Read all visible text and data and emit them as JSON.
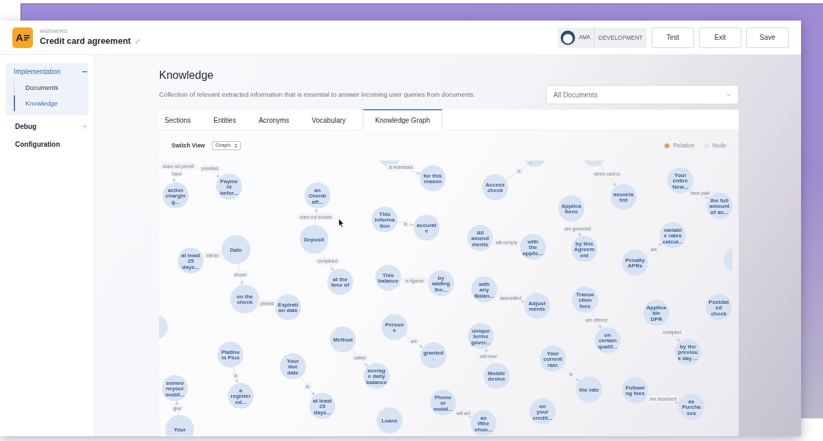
{
  "header": {
    "logo_letter": "A",
    "product": "ANSWERS",
    "title": "Credit card agreement",
    "assistant": "AVA",
    "environment": "DEVELOPMENT",
    "buttons": [
      "Test",
      "Exit",
      "Save"
    ]
  },
  "sidebar": [
    {
      "label": "Implementation",
      "kind": "group",
      "expanded": true,
      "children": [
        {
          "label": "Documents",
          "selected": false
        },
        {
          "label": "Knowledge",
          "selected": true
        }
      ]
    },
    {
      "label": "Debug",
      "kind": "group",
      "expanded": false
    },
    {
      "label": "Configuration",
      "kind": "link"
    }
  ],
  "page": {
    "title": "Knowledge",
    "description": "Collection of relevant extracted information that is essential to answer incoming user queries from documents.",
    "filter": "All Documents"
  },
  "tabs": [
    {
      "label": "Sections",
      "selected": false
    },
    {
      "label": "Entities",
      "selected": false
    },
    {
      "label": "Acronyms",
      "selected": false
    },
    {
      "label": "Vocabulary",
      "selected": false
    },
    {
      "label": "Knowledge Graph",
      "selected": true
    }
  ],
  "graph": {
    "switch_label": "Switch View",
    "view": "Graph",
    "legend": [
      {
        "label": "Relation",
        "color": "#e0a050"
      },
      {
        "label": "Node",
        "color": "#dde3ee"
      }
    ],
    "nodes": [
      {
        "lines": [
          "active",
          "chargin",
          "g..."
        ]
      },
      {
        "lines": [
          "Payme",
          "nt",
          "befor..."
        ]
      },
      {
        "lines": [
          "an",
          "Overdr",
          "aft..."
        ]
      },
      {
        "lines": [
          "for this",
          "reason"
        ]
      },
      {
        "lines": [
          "Access",
          "check"
        ]
      },
      {
        "lines": [
          "Applica",
          "tions"
        ]
      },
      {
        "lines": [
          "associa",
          "ted"
        ]
      },
      {
        "lines": [
          "Your",
          "entire",
          "New..."
        ]
      },
      {
        "lines": [
          "the full",
          "amount",
          "of an..."
        ]
      },
      {
        "lines": [
          "at least",
          "25",
          "days..."
        ]
      },
      {
        "lines": [
          "Date"
        ]
      },
      {
        "lines": [
          "Deposit"
        ]
      },
      {
        "lines": [
          "This",
          "informa",
          "tion"
        ]
      },
      {
        "lines": [
          "accurat",
          "e"
        ]
      },
      {
        "lines": [
          "All",
          "amend",
          "ments"
        ]
      },
      {
        "lines": [
          "with",
          "the",
          "applic..."
        ]
      },
      {
        "lines": [
          "by this",
          "Agreem",
          "ent"
        ]
      },
      {
        "lines": [
          "Penalty",
          "APRs"
        ]
      },
      {
        "lines": [
          "variabl",
          "e rates",
          "calcul..."
        ]
      },
      {
        "lines": [
          "on the",
          "check"
        ]
      },
      {
        "lines": [
          "Expirati",
          "on date"
        ]
      },
      {
        "lines": [
          "at the",
          "time of"
        ]
      },
      {
        "lines": [
          "This",
          "balance"
        ]
      },
      {
        "lines": [
          "by",
          "adding",
          "the..."
        ]
      },
      {
        "lines": [
          "with",
          "any",
          "Balan..."
        ]
      },
      {
        "lines": [
          "Adjust",
          "ments"
        ]
      },
      {
        "lines": [
          "Transa",
          "ction",
          "fees"
        ]
      },
      {
        "lines": [
          "Applica",
          "ble",
          "DPR"
        ]
      },
      {
        "lines": [
          "Postdat",
          "ed",
          "check"
        ]
      },
      {
        "lines": [
          "Platinu",
          "m Plus"
        ]
      },
      {
        "lines": [
          "Your",
          "due",
          "date"
        ]
      },
      {
        "lines": [
          "Method"
        ]
      },
      {
        "lines": [
          "averag",
          "e daily",
          "balance"
        ]
      },
      {
        "lines": [
          "Person",
          "s"
        ]
      },
      {
        "lines": [
          "granted",
          "."
        ]
      },
      {
        "lines": [
          "unique",
          "terms",
          "gover..."
        ]
      },
      {
        "lines": [
          "Mobile",
          "device"
        ]
      },
      {
        "lines": [
          "Your",
          "current",
          "rate"
        ]
      },
      {
        "lines": [
          "on",
          "certain",
          "qualif..."
        ]
      },
      {
        "lines": [
          "by the",
          "previou",
          "s day ..."
        ]
      },
      {
        "lines": [
          "someo",
          "neyour",
          "mobil..."
        ]
      },
      {
        "lines": [
          "Your"
        ]
      },
      {
        "lines": [
          "a",
          "register",
          "ed..."
        ]
      },
      {
        "lines": [
          "at least",
          "25",
          "days..."
        ]
      },
      {
        "lines": [
          "Loans"
        ]
      },
      {
        "lines": [
          "Phone",
          "or",
          "mobil..."
        ]
      },
      {
        "lines": [
          "as",
          "ifthe",
          "ehon..."
        ]
      },
      {
        "lines": [
          "on",
          "your",
          "credit..."
        ]
      },
      {
        "lines": [
          "the rate"
        ]
      },
      {
        "lines": [
          "Followi",
          "ng fees"
        ]
      },
      {
        "lines": [
          "as",
          "Purcha",
          "ses"
        ]
      }
    ],
    "edges": [
      {
        "label": "does not permit"
      },
      {
        "label": "have"
      },
      {
        "label": "provides"
      },
      {
        "label": "is increased"
      },
      {
        "label": "is"
      },
      {
        "label": "which card is"
      },
      {
        "label": "have paid"
      },
      {
        "label": "does not include"
      },
      {
        "label": "is"
      },
      {
        "label": "are governed"
      },
      {
        "label": "will comply"
      },
      {
        "label": "are"
      },
      {
        "label": "will be"
      },
      {
        "label": "completed"
      },
      {
        "label": "shown"
      },
      {
        "label": "is figured"
      },
      {
        "label": "printed"
      },
      {
        "label": "associated"
      },
      {
        "label": "are offered"
      },
      {
        "label": "multiplied"
      },
      {
        "label": "are"
      },
      {
        "label": "called"
      },
      {
        "label": "will have"
      },
      {
        "label": "is"
      },
      {
        "label": "is"
      },
      {
        "label": "is"
      },
      {
        "label": "are assessed"
      },
      {
        "label": "give"
      },
      {
        "label": "will act"
      }
    ]
  }
}
